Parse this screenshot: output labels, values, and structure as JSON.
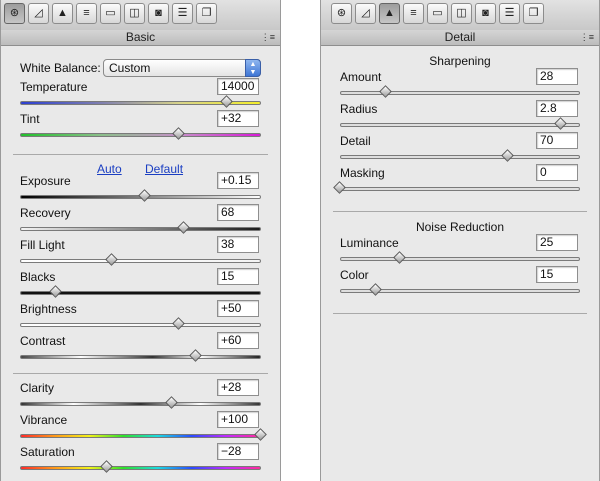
{
  "left_panel": {
    "tabs": [
      {
        "icon": "camera-aperture-icon",
        "glyph": "⊛"
      },
      {
        "icon": "tone-curve-icon",
        "glyph": "◿"
      },
      {
        "icon": "detail-mountain-icon",
        "glyph": "▲"
      },
      {
        "icon": "hsl-bars-icon",
        "glyph": "≡"
      },
      {
        "icon": "split-toning-icon",
        "glyph": "▭"
      },
      {
        "icon": "lens-corrections-icon",
        "glyph": "◫"
      },
      {
        "icon": "camera-calibration-icon",
        "glyph": "◙"
      },
      {
        "icon": "presets-sliders-icon",
        "glyph": "☰"
      },
      {
        "icon": "snapshots-icon",
        "glyph": "❐"
      }
    ],
    "active_tab": 0,
    "title": "Basic",
    "white_balance": {
      "label": "White Balance:",
      "value": "Custom"
    },
    "auto_label": "Auto",
    "default_label": "Default",
    "sliders": [
      {
        "key": "temperature",
        "label": "Temperature",
        "value": "14000",
        "position": 0.86,
        "track": "temperature"
      },
      {
        "key": "tint",
        "label": "Tint",
        "value": "+32",
        "position": 0.66,
        "track": "tint"
      },
      {
        "key": "exposure",
        "label": "Exposure",
        "value": "+0.15",
        "position": 0.52,
        "track": "exposure"
      },
      {
        "key": "recovery",
        "label": "Recovery",
        "value": "68",
        "position": 0.68,
        "track": "recovery"
      },
      {
        "key": "fill-light",
        "label": "Fill Light",
        "value": "38",
        "position": 0.38,
        "track": "fill"
      },
      {
        "key": "blacks",
        "label": "Blacks",
        "value": "15",
        "position": 0.15,
        "track": "blacks"
      },
      {
        "key": "brightness",
        "label": "Brightness",
        "value": "+50",
        "position": 0.66,
        "track": "brightness"
      },
      {
        "key": "contrast",
        "label": "Contrast",
        "value": "+60",
        "position": 0.73,
        "track": "contrast"
      },
      {
        "key": "clarity",
        "label": "Clarity",
        "value": "+28",
        "position": 0.63,
        "track": "clarity"
      },
      {
        "key": "vibrance",
        "label": "Vibrance",
        "value": "+100",
        "position": 1.0,
        "track": "rainbow"
      },
      {
        "key": "saturation",
        "label": "Saturation",
        "value": "−28",
        "position": 0.36,
        "track": "rainbow"
      }
    ]
  },
  "right_panel": {
    "active_tab": 2,
    "title": "Detail",
    "sharpening_title": "Sharpening",
    "noise_title": "Noise Reduction",
    "sliders": [
      {
        "key": "amount",
        "label": "Amount",
        "value": "28",
        "position": 0.19
      },
      {
        "key": "radius",
        "label": "Radius",
        "value": "2.8",
        "position": 0.92
      },
      {
        "key": "detail",
        "label": "Detail",
        "value": "70",
        "position": 0.7
      },
      {
        "key": "masking",
        "label": "Masking",
        "value": "0",
        "position": 0.0
      },
      {
        "key": "luminance",
        "label": "Luminance",
        "value": "25",
        "position": 0.25
      },
      {
        "key": "color",
        "label": "Color",
        "value": "15",
        "position": 0.15
      }
    ]
  },
  "colors": {
    "panel_bg": "#e9e9e9",
    "link_blue": "#1a3ec2",
    "dropdown_blue": "#3e76d5"
  }
}
